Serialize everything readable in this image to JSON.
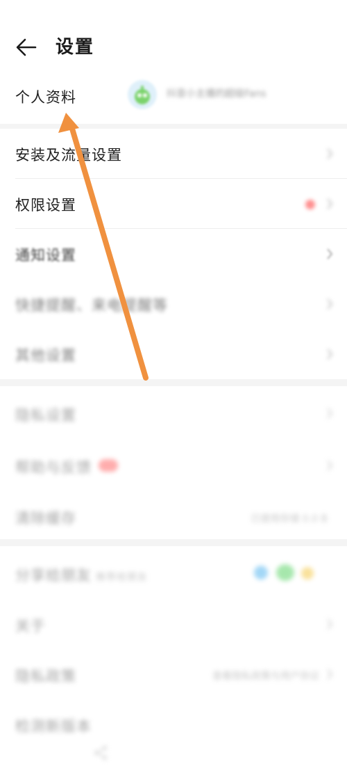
{
  "header": {
    "title": "设置"
  },
  "profile": {
    "label": "个人资料",
    "meta": "抖音小主播的超级Fans"
  },
  "rows": {
    "install_traffic": "安装及流量设置",
    "permissions": "权限设置",
    "notifications": "通知设置",
    "reminder": "快捷提醒、来电提醒等",
    "other": "其他设置",
    "privacy": "隐私设置",
    "help": "帮助与反馈",
    "clear_cache": "清除缓存",
    "clear_cache_value": "已使用存储 0.0 B",
    "share": "分享给朋友",
    "share_sub": "推荐给朋友",
    "about": "关于",
    "privacy_policy": "隐私政策",
    "privacy_policy_value": "查看隐私政策与用户协议",
    "check_update": "检测新版本"
  },
  "colors": {
    "arrow": "#f0913f",
    "badge_red": "#ff6a6a",
    "share_blue": "#57b6ef",
    "share_green": "#5fd46a",
    "share_yellow": "#f5c94a"
  }
}
